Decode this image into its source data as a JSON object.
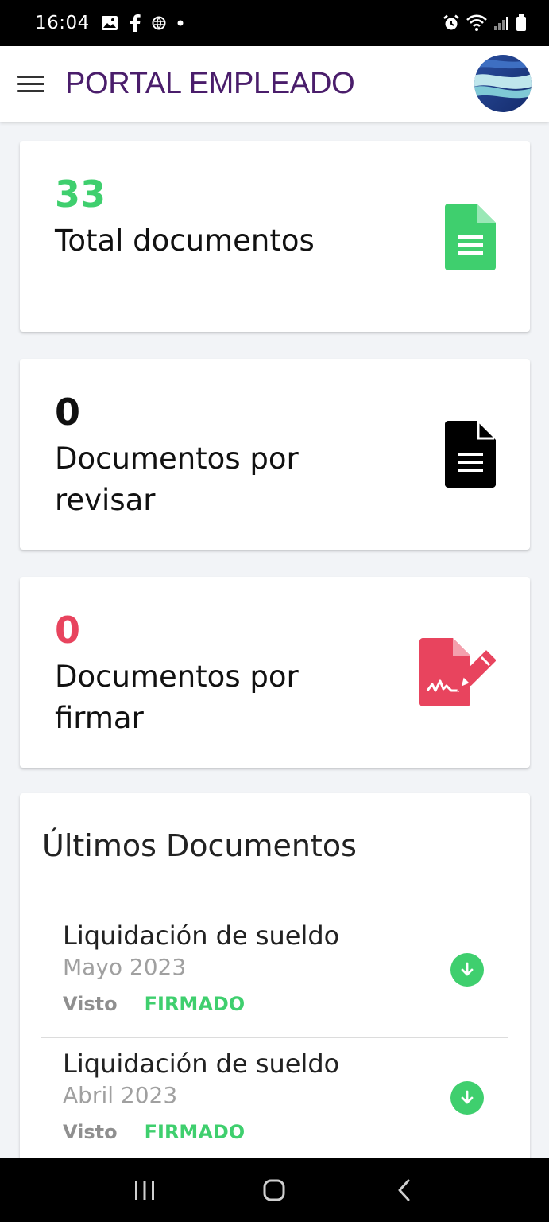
{
  "status_bar": {
    "time": "16:04"
  },
  "app_bar": {
    "title": "PORTAL EMPLEADO"
  },
  "stats": [
    {
      "value": "33",
      "label": "Total documentos",
      "color": "#3fcf6e",
      "icon": "document-icon"
    },
    {
      "value": "0",
      "label": "Documentos por revisar",
      "color": "#111111",
      "icon": "document-review-icon"
    },
    {
      "value": "0",
      "label": "Documentos por firmar",
      "color": "#e8445e",
      "icon": "document-sign-icon"
    }
  ],
  "latest": {
    "title": "Últimos Documentos",
    "items": [
      {
        "name": "Liquidación de sueldo",
        "period": "Mayo 2023",
        "seen": "Visto",
        "signed": "FIRMADO"
      },
      {
        "name": "Liquidación de sueldo",
        "period": "Abril 2023",
        "seen": "Visto",
        "signed": "FIRMADO"
      }
    ]
  },
  "colors": {
    "brand": "#4a1d6b",
    "success": "#3fcf6e",
    "danger": "#e8445e"
  }
}
